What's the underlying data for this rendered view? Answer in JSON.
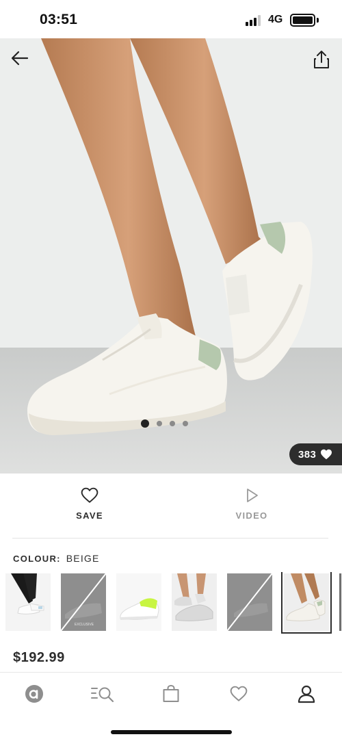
{
  "status_bar": {
    "time": "03:51",
    "network": "4G"
  },
  "product": {
    "likes": "383",
    "carousel": {
      "count": 4,
      "active_index": 0
    },
    "actions": {
      "save_label": "SAVE",
      "video_label": "VIDEO"
    },
    "colour": {
      "label": "COLOUR:",
      "value": "BEIGE"
    },
    "thumbnails": [
      {
        "name": "legs-black-leggings",
        "available": true,
        "selected": false
      },
      {
        "name": "exclusive-unavailable",
        "available": false,
        "selected": false,
        "caption": "EXCLUSIVE"
      },
      {
        "name": "white-neon-sneaker",
        "available": true,
        "selected": false
      },
      {
        "name": "legs-grey-sneakers",
        "available": true,
        "selected": false
      },
      {
        "name": "unavailable-variant",
        "available": false,
        "selected": false
      },
      {
        "name": "beige-sneakers",
        "available": true,
        "selected": true
      }
    ],
    "price": "$192.99"
  },
  "icons": {
    "back": "arrow-left-icon",
    "share": "share-icon",
    "likes": "heart-filled-icon",
    "save": "heart-outline-icon",
    "video": "play-icon"
  },
  "bottom_nav": [
    {
      "name": "home",
      "icon": "brand-logo-icon"
    },
    {
      "name": "search",
      "icon": "search-icon"
    },
    {
      "name": "bag",
      "icon": "bag-icon"
    },
    {
      "name": "saved",
      "icon": "heart-icon"
    },
    {
      "name": "account",
      "icon": "user-icon"
    }
  ],
  "colors": {
    "text": "#2d2d2d",
    "muted": "#999999",
    "badge_bg": "#2d2d2d",
    "accent_neon": "#c8f542"
  }
}
